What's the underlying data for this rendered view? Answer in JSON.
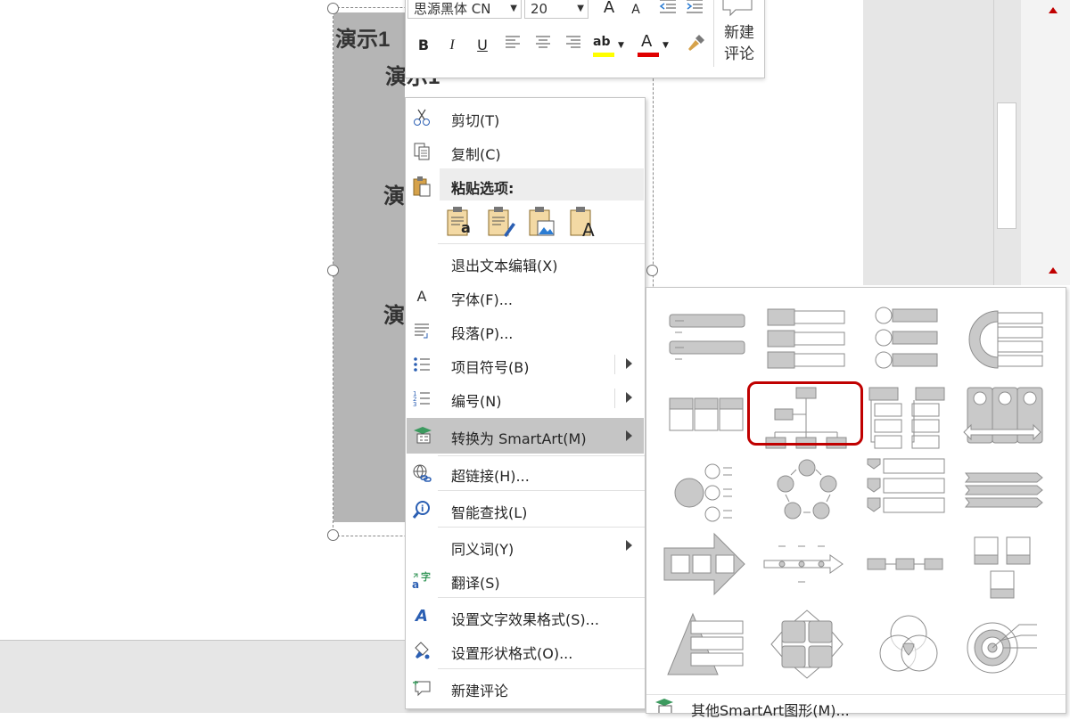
{
  "slide": {
    "text_top": "演示1",
    "text_line2": "演示1",
    "text_line3": "演",
    "text_line4": "演"
  },
  "mini_toolbar": {
    "font_name": "思源黑体 CN",
    "font_size": "20",
    "grow_font": "A",
    "shrink_font": "A",
    "bold": "B",
    "italic": "I",
    "underline": "U",
    "highlight_glyph": "ab",
    "font_color_glyph": "A",
    "new_comment": "新建\n评论"
  },
  "context_menu": {
    "items": [
      {
        "label": "剪切(T)",
        "icon": "scissors-icon"
      },
      {
        "label": "复制(C)",
        "icon": "copy-icon"
      },
      {
        "label": "粘贴选项:",
        "icon": "paste-icon"
      },
      {
        "label": "退出文本编辑(X)",
        "icon": ""
      },
      {
        "label": "字体(F)...",
        "icon": "font-icon"
      },
      {
        "label": "段落(P)...",
        "icon": "paragraph-icon"
      },
      {
        "label": "项目符号(B)",
        "icon": "bullets-icon"
      },
      {
        "label": "编号(N)",
        "icon": "numbering-icon"
      },
      {
        "label": "转换为 SmartArt(M)",
        "icon": "smartart-icon"
      },
      {
        "label": "超链接(H)...",
        "icon": "hyperlink-icon"
      },
      {
        "label": "智能查找(L)",
        "icon": "smart-lookup-icon"
      },
      {
        "label": "同义词(Y)",
        "icon": ""
      },
      {
        "label": "翻译(S)",
        "icon": "translate-icon"
      },
      {
        "label": "设置文字效果格式(S)...",
        "icon": "text-effects-icon"
      },
      {
        "label": "设置形状格式(O)...",
        "icon": "shape-format-icon"
      },
      {
        "label": "新建评论",
        "icon": "new-comment-icon"
      }
    ],
    "font_glyph": "A",
    "paste_glyphs": [
      "a",
      "",
      "",
      "A"
    ]
  },
  "smartart_gallery": {
    "footer_label": "其他SmartArt图形(M)...",
    "selected_layout": "organization-chart"
  },
  "colors": {
    "highlight_red": "#c00000",
    "menu_hover": "#c5c5c5",
    "smartart_gray": "#c9c9c9"
  }
}
